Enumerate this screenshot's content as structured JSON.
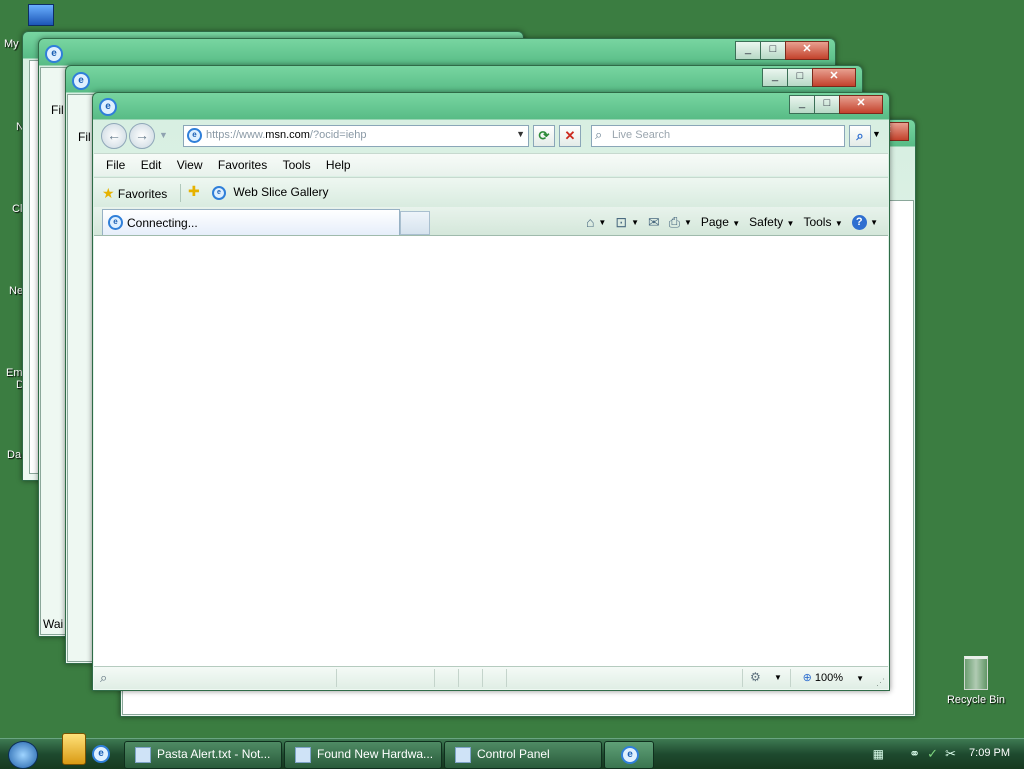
{
  "desktop": {
    "icon_labels": [
      "My",
      "N",
      "Cl",
      "Ne",
      "Em",
      "D",
      "Da"
    ],
    "recycle_bin": "Recycle Bin"
  },
  "background_windows": {
    "menu_fragment": "Fil",
    "status_fragment": "Wai"
  },
  "ie": {
    "address_prefix": "https://www.",
    "address_domain": "msn.com",
    "address_suffix": "/?ocid=iehp",
    "search_placeholder": "Live Search",
    "menu": [
      "File",
      "Edit",
      "View",
      "Favorites",
      "Tools",
      "Help"
    ],
    "favorites_label": "Favorites",
    "web_slice_label": "Web Slice Gallery",
    "tab_label": "Connecting...",
    "commands": {
      "page": "Page",
      "safety": "Safety",
      "tools": "Tools"
    },
    "zoom": "100%"
  },
  "taskbar": {
    "buttons": [
      {
        "label": "Pasta Alert.txt - Not..."
      },
      {
        "label": "Found New Hardwa..."
      },
      {
        "label": "Control Panel"
      }
    ],
    "clock": "7:09 PM"
  },
  "colors": {
    "desktop": "#3b7d41",
    "window_frame": "#58bc86",
    "taskbar": "#1e4a2f"
  }
}
